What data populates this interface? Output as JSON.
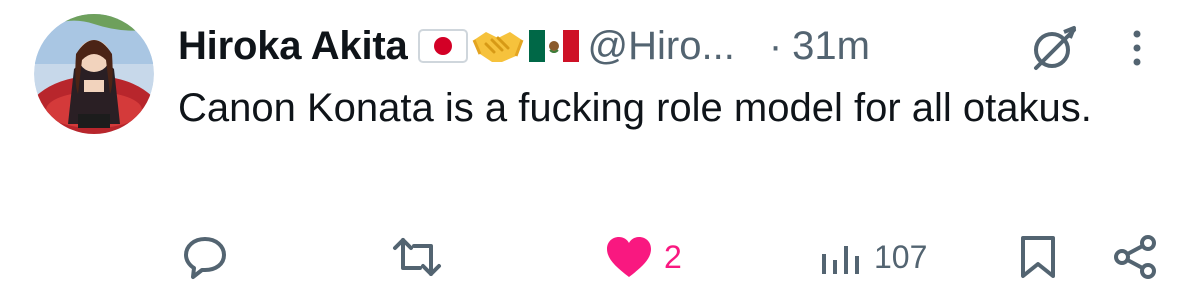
{
  "author": {
    "display_name": "Hiroka Akita",
    "handle": "@Hiro...",
    "separator": "·",
    "timestamp": "31m",
    "emojis": [
      "japan-flag",
      "handshake",
      "mexico-flag"
    ]
  },
  "tweet": {
    "text": "Canon Konata is a fucking role model for all otakus."
  },
  "actions": {
    "reply": {
      "icon": "reply-icon"
    },
    "retweet": {
      "icon": "retweet-icon"
    },
    "like": {
      "icon": "heart-icon",
      "count": "2",
      "liked": true
    },
    "views": {
      "icon": "analytics-icon",
      "count": "107"
    },
    "bookmark": {
      "icon": "bookmark-icon"
    },
    "share": {
      "icon": "share-icon"
    }
  },
  "colors": {
    "text_primary": "#0f1419",
    "text_secondary": "#536471",
    "like_active": "#f91880"
  }
}
